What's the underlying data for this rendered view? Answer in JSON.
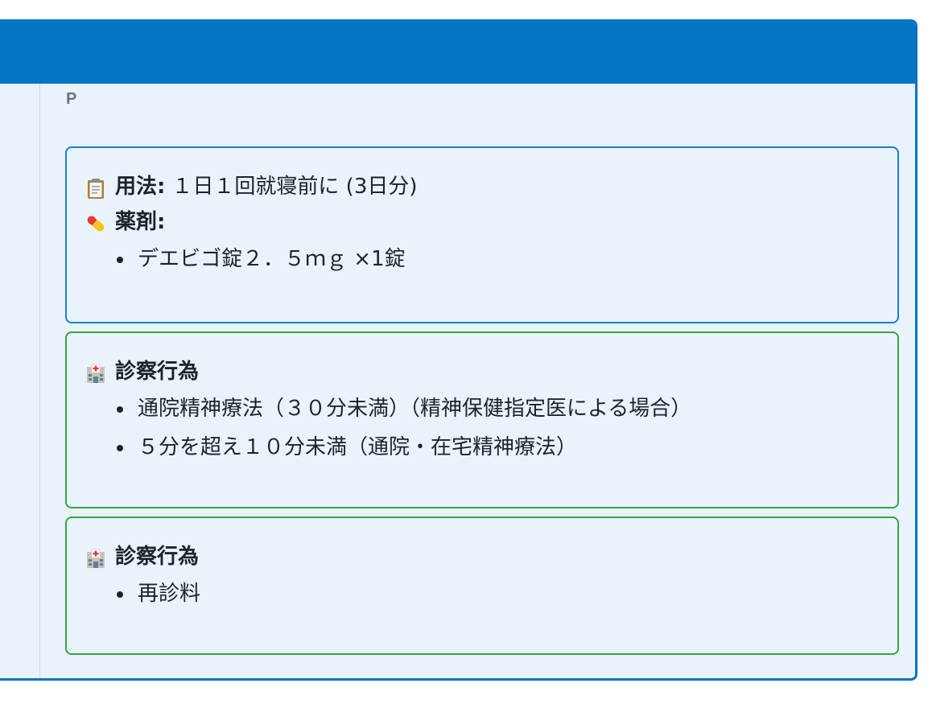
{
  "section": {
    "label": "P"
  },
  "prescription": {
    "usage_label": "用法:",
    "usage_value": "１日１回就寝前に (3日分)",
    "drug_label": "薬剤:",
    "drugs": [
      "デエビゴ錠２．５ｍｇ ×1錠"
    ],
    "icons": {
      "usage": "clipboard-icon",
      "drug": "pill-icon"
    }
  },
  "procedures": [
    {
      "title": "診察行為",
      "icon": "hospital-icon",
      "items": [
        "通院精神療法（３０分未満）（精神保健指定医による場合）",
        "５分を超え１０分未満（通院・在宅精神療法）"
      ]
    },
    {
      "title": "診察行為",
      "icon": "hospital-icon",
      "items": [
        "再診料"
      ]
    }
  ],
  "colors": {
    "header": "#0474c3",
    "panel_bg": "#e9f3fc",
    "prescription_border": "#1d7fd0",
    "procedure_border": "#3aa24a"
  }
}
